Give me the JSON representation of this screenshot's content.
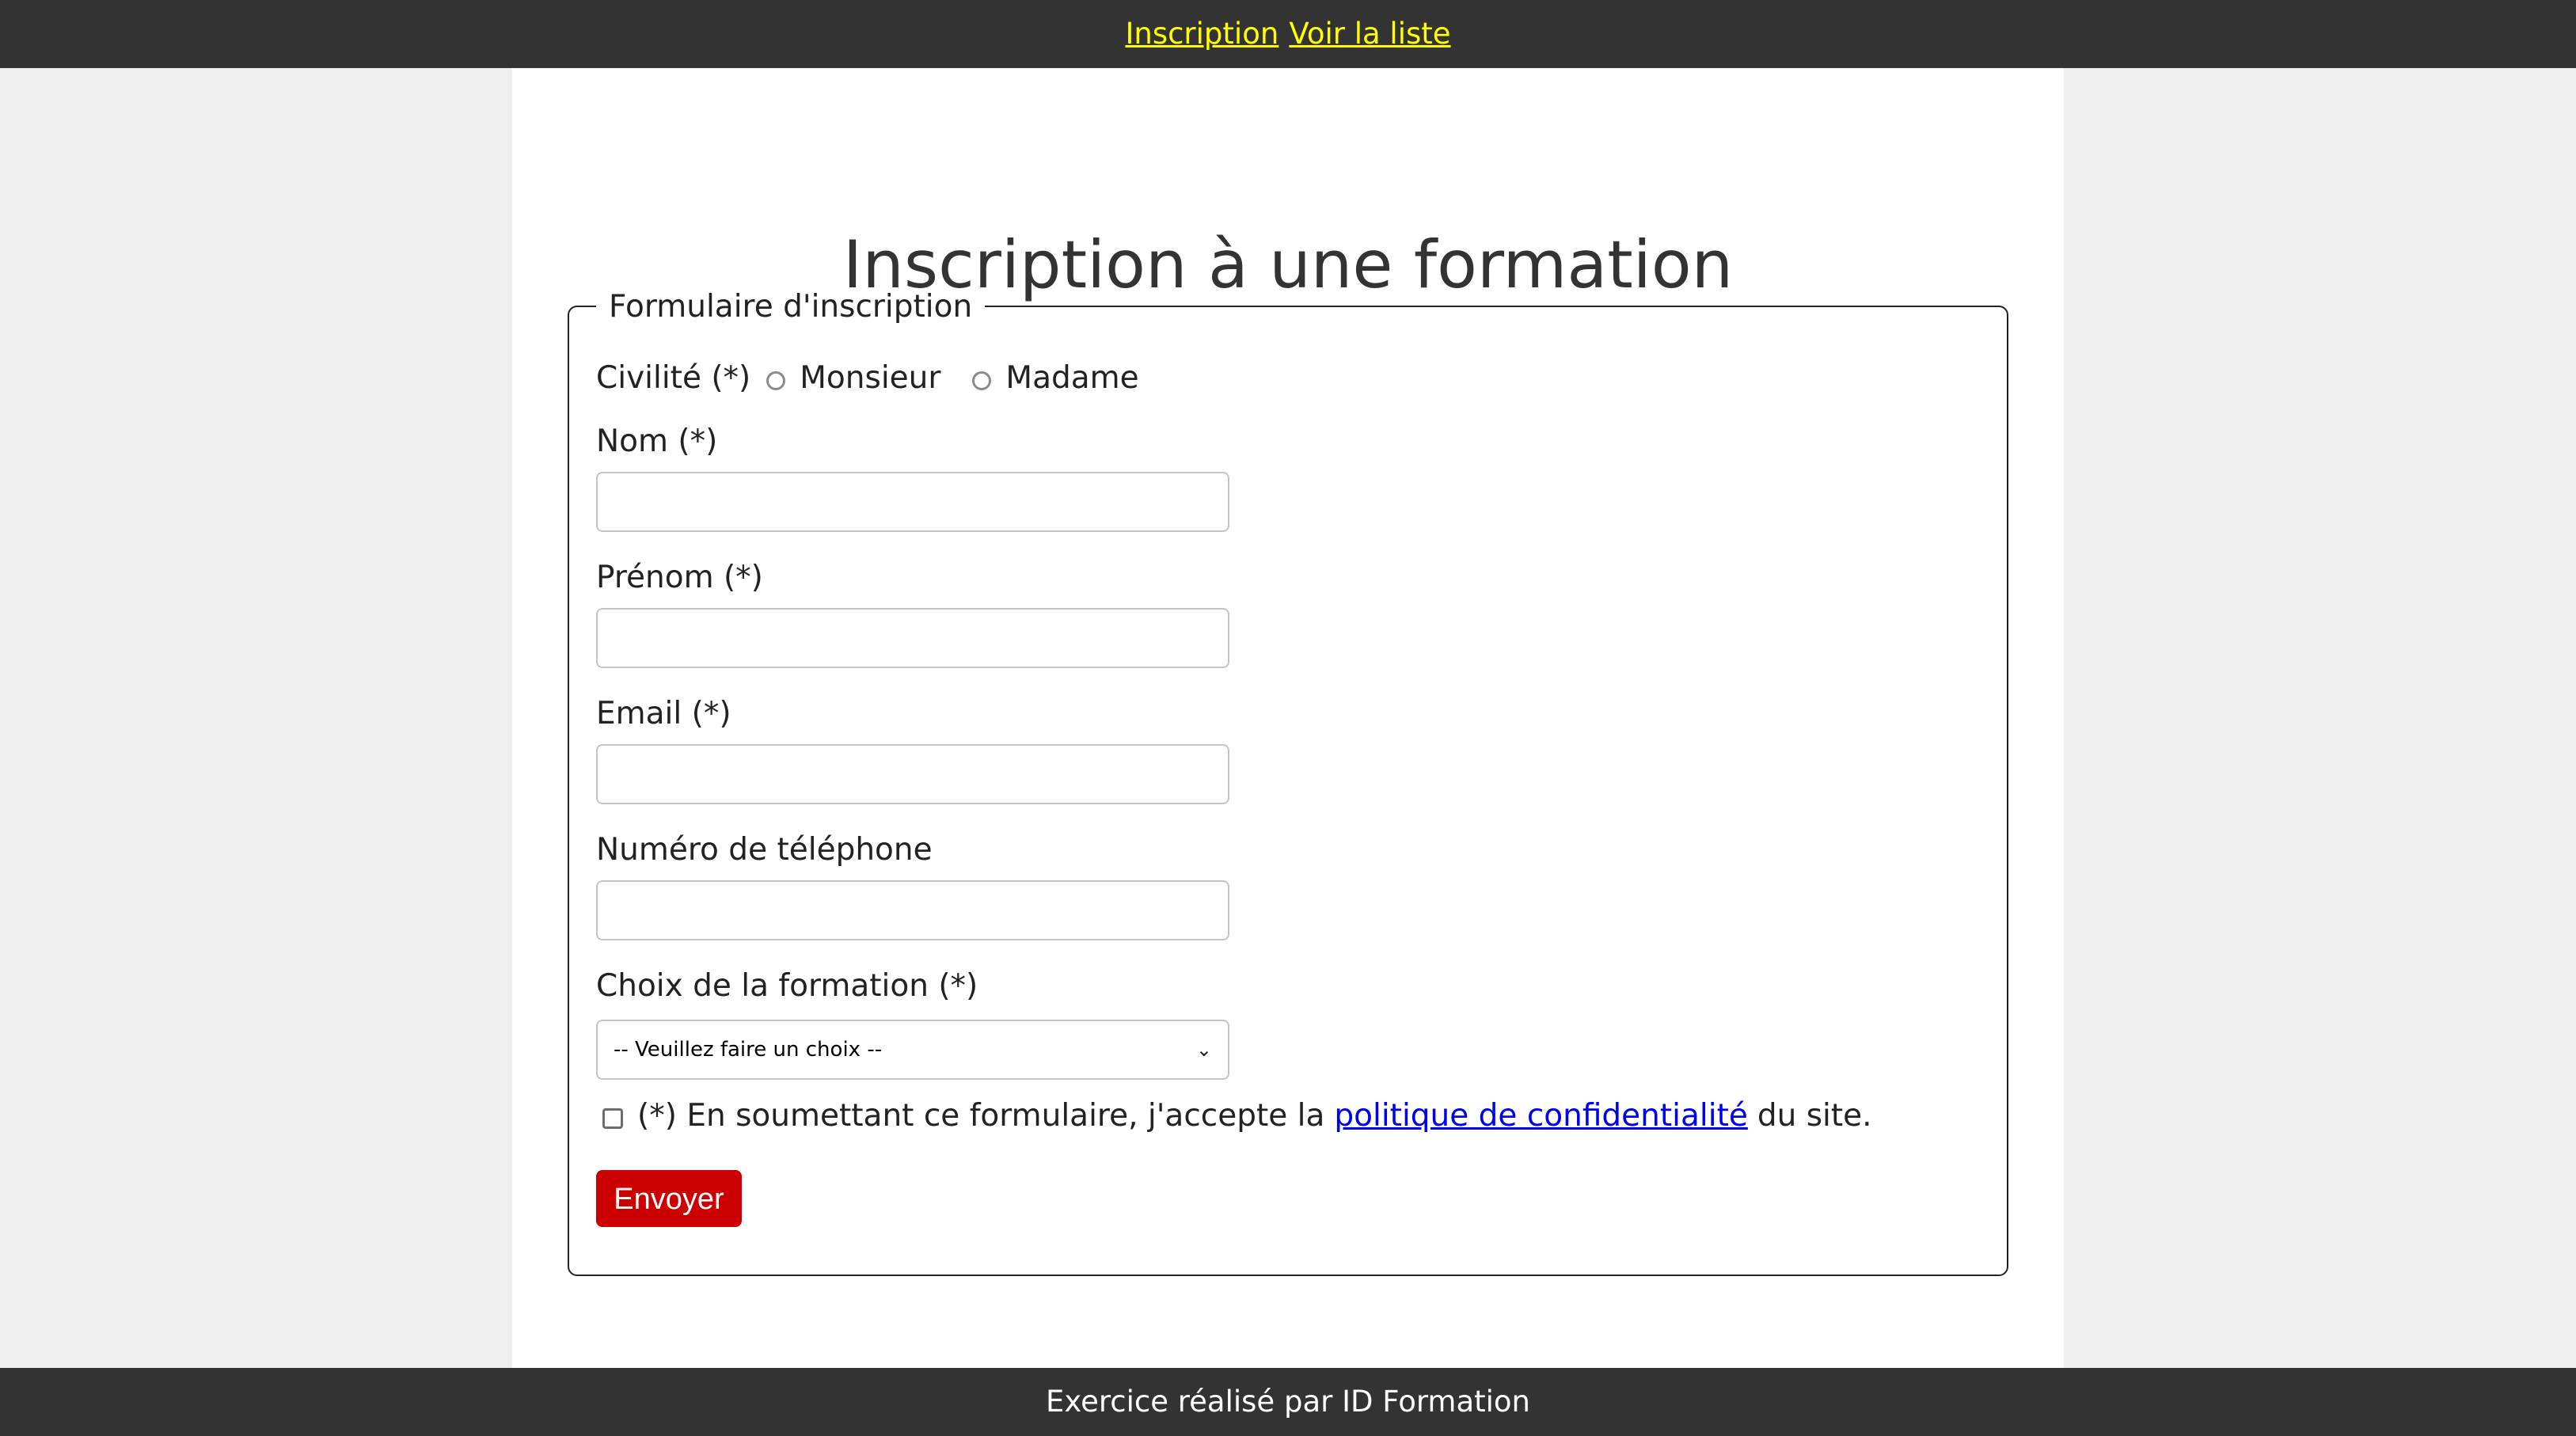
{
  "nav": {
    "inscription": "Inscription",
    "voir_liste": "Voir la liste"
  },
  "page": {
    "title": "Inscription à une formation"
  },
  "form": {
    "legend": "Formulaire d'inscription",
    "civilite": {
      "label": "Civilité (*)",
      "options": [
        "Monsieur",
        "Madame"
      ]
    },
    "nom_label": "Nom (*)",
    "prenom_label": "Prénom (*)",
    "email_label": "Email (*)",
    "telephone_label": "Numéro de téléphone",
    "formation": {
      "label": "Choix de la formation (*)",
      "selected": "-- Veuillez faire un choix --"
    },
    "consent": {
      "before": "(*) En soumettant ce formulaire, j'accepte la",
      "link": "politique de confidentialité",
      "after": "du site."
    },
    "submit_label": "Envoyer"
  },
  "footer": {
    "text": "Exercice réalisé par ID Formation"
  },
  "colors": {
    "bar": "#333333",
    "nav_link": "#ffff00",
    "submit": "#cc0000",
    "link": "#0000ee"
  }
}
